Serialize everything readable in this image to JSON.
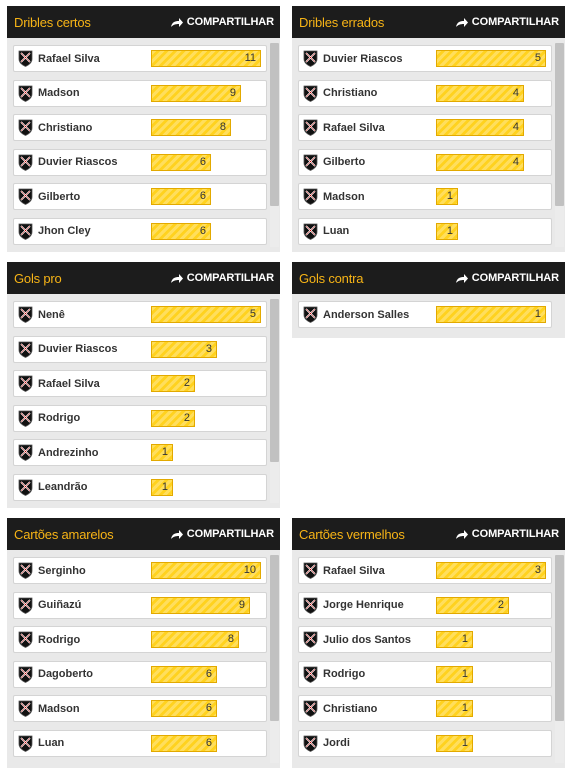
{
  "share_label": "COMPARTILHAR",
  "max_bar": 110,
  "panels": [
    {
      "title": "Dribles certos",
      "rows": [
        [
          "Rafael Silva",
          11
        ],
        [
          "Madson",
          9
        ],
        [
          "Christiano",
          8
        ],
        [
          "Duvier Riascos",
          6
        ],
        [
          "Gilberto",
          6
        ],
        [
          "Jhon Cley",
          6
        ]
      ]
    },
    {
      "title": "Dribles errados",
      "rows": [
        [
          "Duvier Riascos",
          5
        ],
        [
          "Christiano",
          4
        ],
        [
          "Rafael Silva",
          4
        ],
        [
          "Gilberto",
          4
        ],
        [
          "Madson",
          1
        ],
        [
          "Luan",
          1
        ]
      ]
    },
    {
      "title": "Gols pro",
      "rows": [
        [
          "Nenê",
          5
        ],
        [
          "Duvier Riascos",
          3
        ],
        [
          "Rafael Silva",
          2
        ],
        [
          "Rodrigo",
          2
        ],
        [
          "Andrezinho",
          1
        ],
        [
          "Leandrão",
          1
        ]
      ]
    },
    {
      "title": "Gols contra",
      "rows": [
        [
          "Anderson Salles",
          1
        ]
      ]
    },
    {
      "title": "Cartões amarelos",
      "rows": [
        [
          "Serginho",
          10
        ],
        [
          "Guiñazú",
          9
        ],
        [
          "Rodrigo",
          8
        ],
        [
          "Dagoberto",
          6
        ],
        [
          "Madson",
          6
        ],
        [
          "Luan",
          6
        ]
      ]
    },
    {
      "title": "Cartões vermelhos",
      "rows": [
        [
          "Rafael Silva",
          3
        ],
        [
          "Jorge Henrique",
          2
        ],
        [
          "Julio dos Santos",
          1
        ],
        [
          "Rodrigo",
          1
        ],
        [
          "Christiano",
          1
        ],
        [
          "Jordi",
          1
        ]
      ]
    }
  ]
}
